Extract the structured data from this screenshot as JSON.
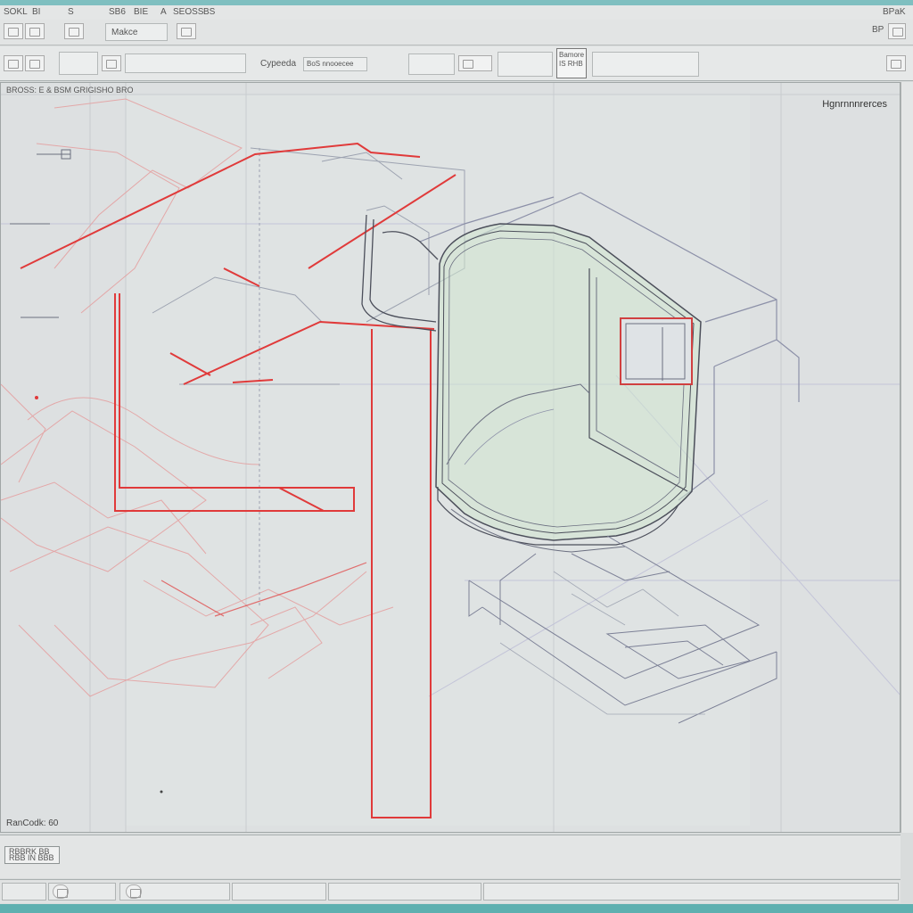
{
  "menu": {
    "items": [
      "SOKL",
      "BI",
      "S",
      "SB6",
      "BIE",
      "A",
      "SEOSS",
      "BS"
    ],
    "right_label": "BPaK"
  },
  "toolbar1": {
    "make_label": "Makce",
    "right_label": "BP"
  },
  "toolbar2": {
    "field1": "Cypeeda",
    "field2": "BoS nnooecee",
    "box_label_1": "Bamore",
    "box_label_2": "IS RHB"
  },
  "canvas": {
    "header": "BROSS: E & BSM GRIGISHO BRO",
    "view_label": "Hgnrnnnrerces",
    "coord_label": "RanCodk: 60"
  },
  "command": {
    "button_line1": "RBBRK BB",
    "button_line2": "RBB IN BBB"
  },
  "colors": {
    "accent_red": "#e03a3a",
    "line_gray": "#6b6f80",
    "tint_green": "#cfe6d0",
    "taskbar": "#5fb0b0"
  }
}
